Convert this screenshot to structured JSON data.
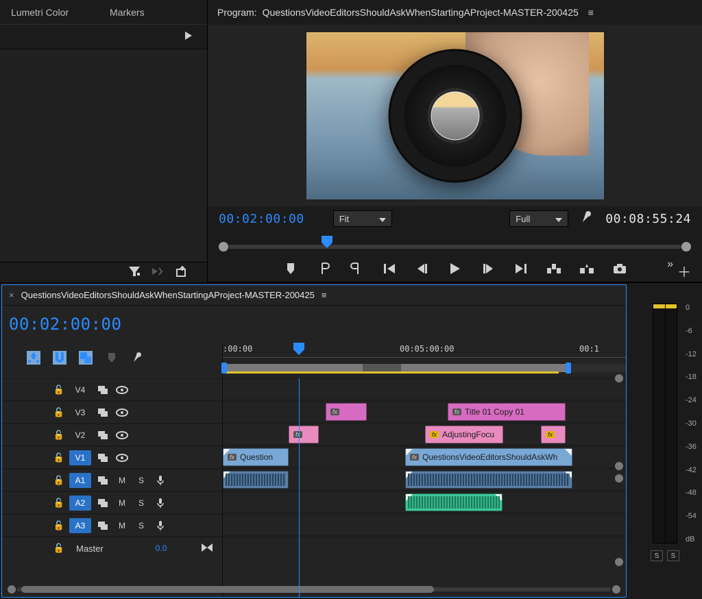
{
  "top_tabs": {
    "lumetri": "Lumetri Color",
    "markers": "Markers"
  },
  "program": {
    "header_prefix": "Program:",
    "title": "QuestionsVideoEditorsShouldAskWhenStartingAProject-MASTER-200425",
    "current_tc": "00:02:00:00",
    "duration_tc": "00:08:55:24",
    "fit_label": "Fit",
    "full_label": "Full"
  },
  "timeline": {
    "title": "QuestionsVideoEditorsShouldAskWhenStartingAProject-MASTER-200425",
    "current_tc": "00:02:00:00",
    "ruler": {
      "t0": ":00:00",
      "t1": "00:05:00:00",
      "t2": "00:1"
    },
    "tracks": {
      "v4": "V4",
      "v3": "V3",
      "v2": "V2",
      "v1": "V1",
      "a1": "A1",
      "a2": "A2",
      "a3": "A3",
      "master": "Master",
      "master_val": "0.0",
      "m": "M",
      "s": "S"
    },
    "clips": {
      "v3_title": "Title 01 Copy 01",
      "v2_adjust": "AdjustingFocu",
      "v1_q": "Question",
      "v1_long": "QuestionsVideoEditorsShouldAskWh"
    }
  },
  "meter": {
    "scale": [
      "0",
      "-6",
      "-12",
      "-18",
      "-24",
      "-30",
      "-36",
      "-42",
      "-48",
      "-54",
      "dB"
    ],
    "solo": "S"
  },
  "icons": {
    "fx": "fx"
  }
}
